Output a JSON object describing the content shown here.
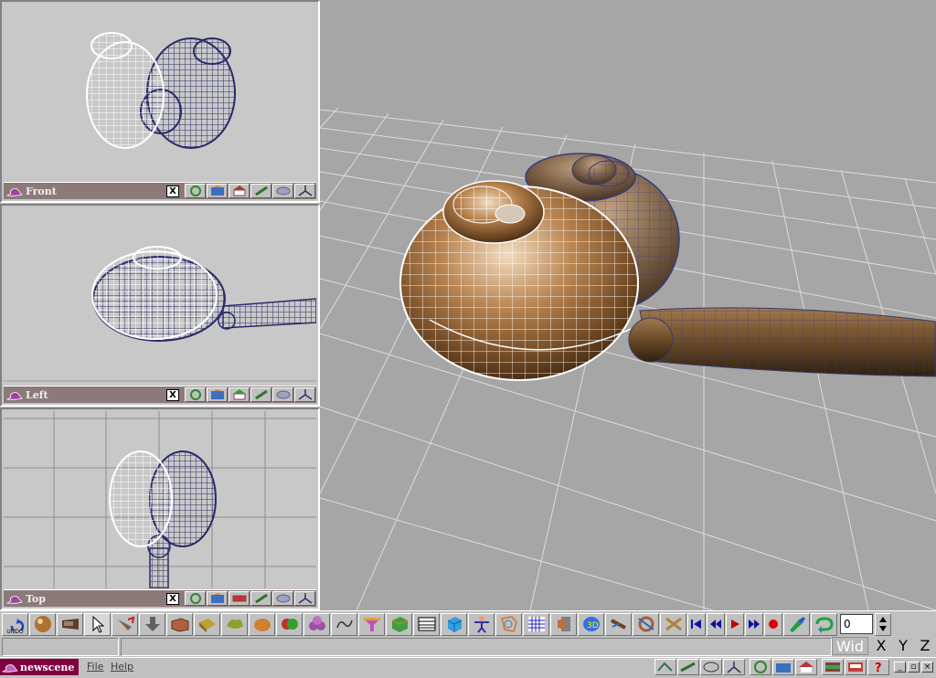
{
  "viewports": {
    "front": {
      "label": "Front"
    },
    "left": {
      "label": "Left"
    },
    "top": {
      "label": "Top"
    }
  },
  "viewport_close_glyph": "X",
  "toolbar": {
    "undo_label": "UNDO",
    "frame_value": "0"
  },
  "status": {
    "wid_label": "Wid",
    "x_label": "X",
    "y_label": "Y",
    "z_label": "Z"
  },
  "menubar": {
    "scene_name": "newscene",
    "file_label": "File",
    "help_label": "Help"
  },
  "colors": {
    "viewport_title_bg": "#8c7a7a",
    "scene_tab_bg": "#800040",
    "wireframe_white": "#ffffff",
    "wireframe_blue": "#2a2a6a",
    "shell_brown": "#8a5e2e"
  },
  "icons": [
    "undo-icon",
    "sphere-icon",
    "camera-icon",
    "select-arrow-icon",
    "move-icon",
    "down-arrow-icon",
    "box-icon",
    "cube-icon",
    "lathe-icon",
    "egg-icon",
    "boolean-icon",
    "metaball-icon",
    "spline-icon",
    "funnel-icon",
    "extrude-icon",
    "list-icon",
    "cube3d-icon",
    "figure-icon",
    "texture-icon",
    "grid-icon",
    "film-icon",
    "3d-icon",
    "bones-icon",
    "render-icon",
    "keyframe-icon",
    "rewind-start-icon",
    "rewind-icon",
    "play-icon",
    "forward-icon",
    "record-icon",
    "paint-icon",
    "loop-icon",
    "spin-arrows-icon"
  ]
}
